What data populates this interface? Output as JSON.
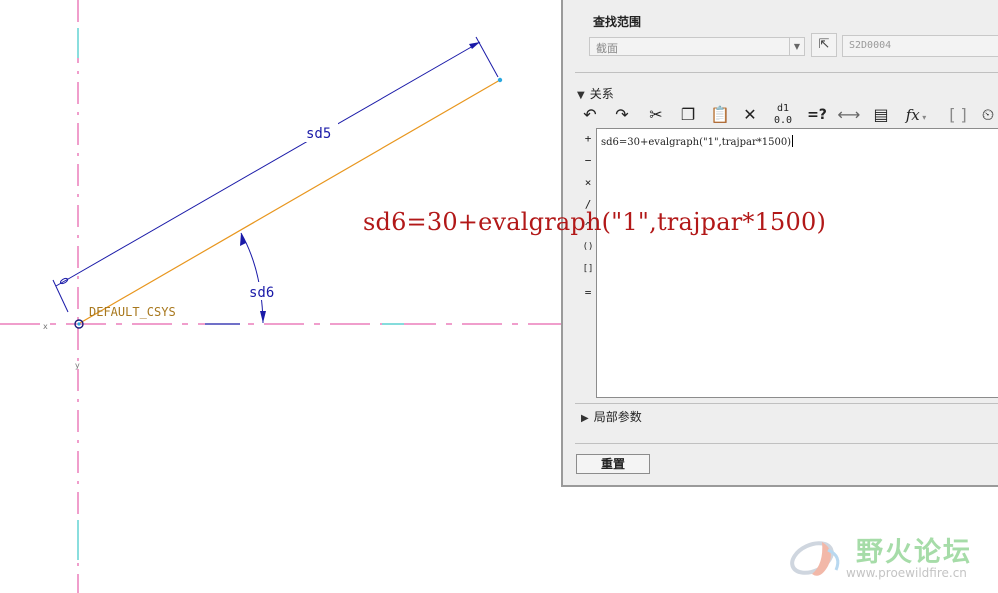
{
  "sketch": {
    "dim_length_label": "sd5",
    "dim_angle_label": "sd6",
    "csys_label": "DEFAULT_CSYS",
    "axis_marker_x": "x",
    "axis_marker_y": "y"
  },
  "annotation": {
    "relation_text": "sd6=30+evalgraph(\"1\",trajpar*1500)"
  },
  "colors": {
    "dimension": "#1a1aa8",
    "geometry": "#e8961e",
    "centerline": "#e23c9a",
    "annotation": "#b21818"
  },
  "panel": {
    "lookup_title": "查找范围",
    "lookup_dropdown_value": "截面",
    "lookup_field_value": "S2D0004",
    "relations_title": "关系",
    "local_params_title": "局部参数",
    "reset_label": "重置",
    "toolbar_icons": [
      "undo-icon",
      "redo-icon",
      "cut-icon",
      "copy-icon",
      "paste-icon",
      "delete-icon",
      "toggle-dimension-icon",
      "evaluate-icon",
      "insert-dimension-icon",
      "insert-parameter-icon",
      "insert-function-icon",
      "bracket-icon",
      "sort-units-icon"
    ],
    "toolbar_eval_label": "=?",
    "toolbar_func_label": "fx",
    "operators": [
      "+",
      "−",
      "×",
      "/",
      "^",
      "()",
      "[]",
      "="
    ],
    "editor_text": "sd6=30+evalgraph(\"1\",trajpar*1500)"
  },
  "watermark": {
    "title": "野火论坛",
    "url": "www.proewildfire.cn"
  }
}
